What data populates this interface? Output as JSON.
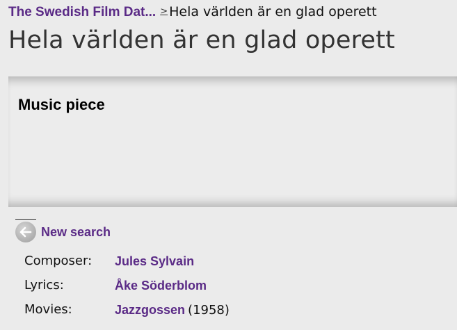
{
  "breadcrumb": {
    "root_label": "The Swedish Film Dat...",
    "separator": ">",
    "current": "Hela världen är en glad operett"
  },
  "page": {
    "title": "Hela världen är en glad operett"
  },
  "panel": {
    "heading": "Music piece"
  },
  "nav": {
    "back_icon": "back-arrow-icon",
    "new_search_label": "New search"
  },
  "details": {
    "composer_label": "Composer:",
    "composer_value": "Jules Sylvain",
    "lyrics_label": "Lyrics:",
    "lyrics_value": "Åke Söderblom",
    "movies_label": "Movies:",
    "movies_value": "Jazzgossen",
    "movies_year": "(1958)"
  },
  "colors": {
    "link": "#5a2a86",
    "background": "#ebebeb"
  }
}
